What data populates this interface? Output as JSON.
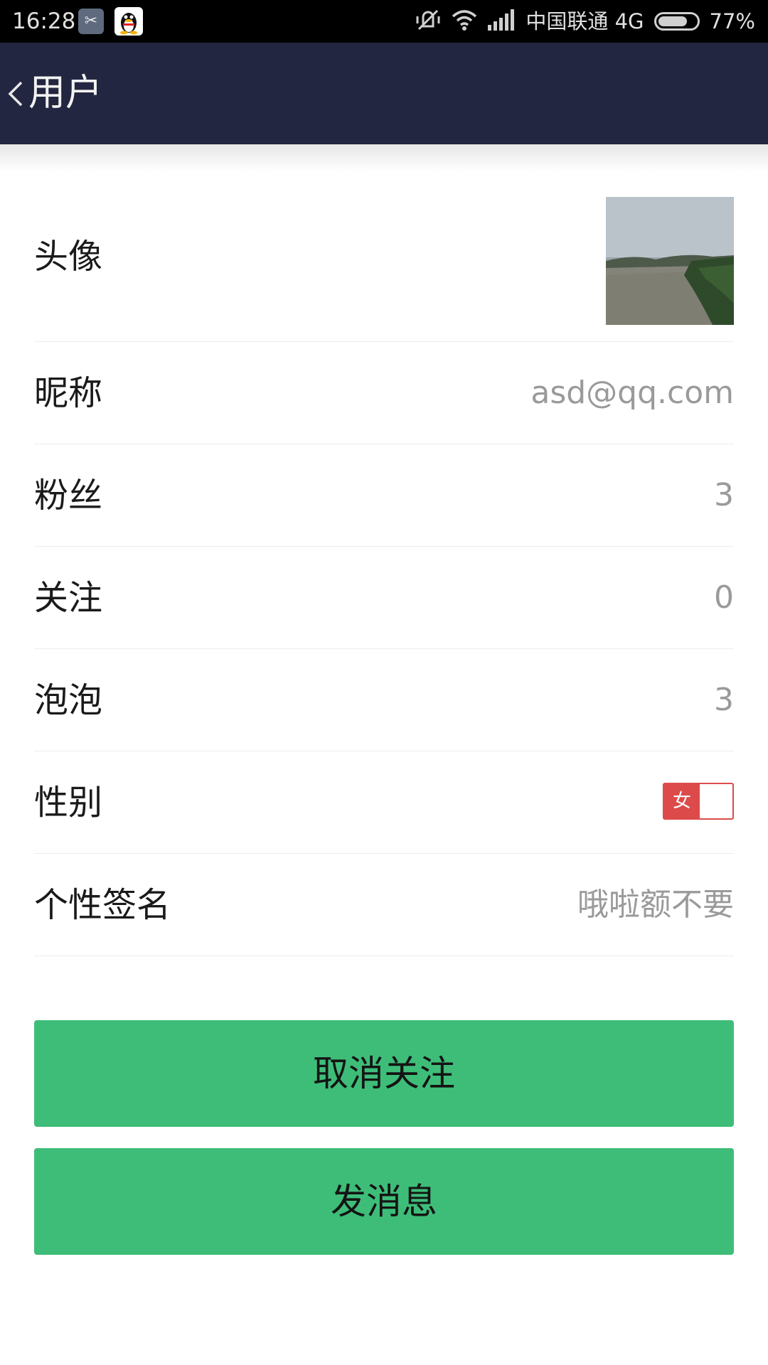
{
  "status_bar": {
    "time": "16:28",
    "carrier": "中国联通 4G",
    "battery_percent": "77%",
    "battery_level": 0.77
  },
  "header": {
    "back_icon": "chevron-left-icon",
    "title": "用户",
    "background": "#232640"
  },
  "profile": {
    "avatar_label": "头像",
    "nickname_label": "昵称",
    "nickname_value": "asd@qq.com",
    "fans_label": "粉丝",
    "fans_value": "3",
    "following_label": "关注",
    "following_value": "0",
    "bubbles_label": "泡泡",
    "bubbles_value": "3",
    "gender_label": "性别",
    "gender_value": "女",
    "signature_label": "个性签名",
    "signature_value": "哦啦额不要"
  },
  "actions": {
    "unfollow_label": "取消关注",
    "message_label": "发消息",
    "button_color": "#3ebd79"
  },
  "colors": {
    "toggle_red": "#dd4a4a"
  }
}
